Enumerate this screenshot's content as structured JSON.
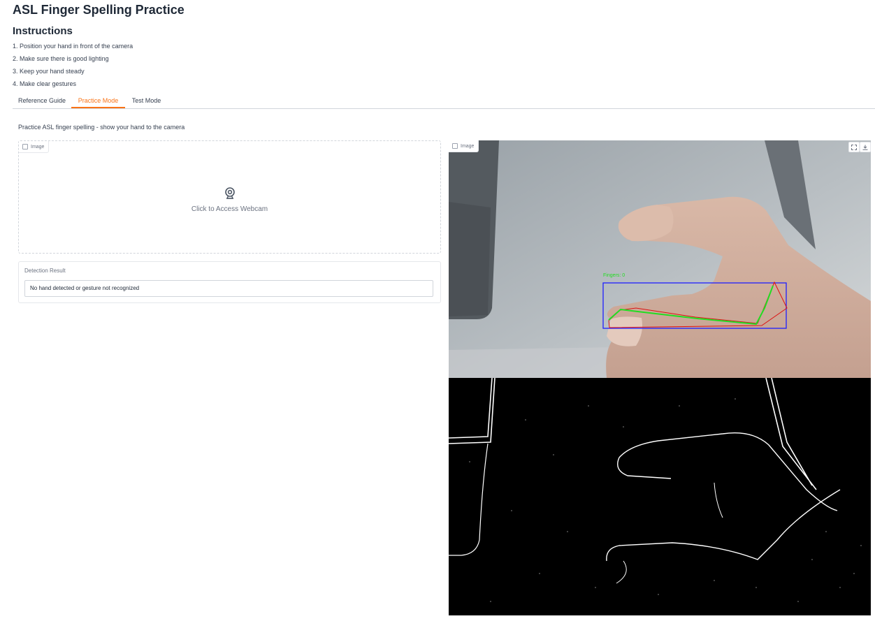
{
  "page": {
    "title": "ASL Finger Spelling Practice"
  },
  "instructions": {
    "heading": "Instructions",
    "steps": [
      "1. Position your hand in front of the camera",
      "2. Make sure there is good lighting",
      "3. Keep your hand steady",
      "4. Make clear gestures"
    ]
  },
  "tabs": [
    "Reference Guide",
    "Practice Mode",
    "Test Mode"
  ],
  "active_tab": "Practice Mode",
  "practice": {
    "subtitle": "Practice ASL finger spelling - show your hand to the camera",
    "input_image": {
      "label": "Image",
      "webcam_text": "Click to Access Webcam"
    },
    "result": {
      "label": "Detection Result",
      "value": "No hand detected or gesture not recognized"
    },
    "output_image": {
      "label": "Image",
      "overlay_text": "Fingers: 0"
    }
  },
  "icons": {
    "image_chip": "image-icon",
    "webcam": "webcam-icon",
    "fullscreen": "fullscreen-icon",
    "download": "download-icon"
  },
  "colors": {
    "accent": "#f97316",
    "bbox": "#1e1eff",
    "contour": "#22dd22",
    "hull": "#dd1111"
  }
}
